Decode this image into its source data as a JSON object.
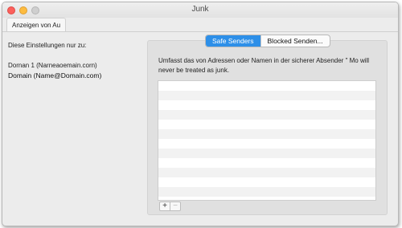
{
  "window": {
    "title": "Junk"
  },
  "toolbar": {
    "tab_label": "Anzeigen von Au"
  },
  "left_pane": {
    "settings_label": "Diese Einstellungen nur zu:",
    "account_name": "Dornan 1 (Narneaoemain.corn)",
    "account_address": "Domain (Name@Domain.com)"
  },
  "segmented": {
    "safe_label": "Safe Senders",
    "blocked_label": "Blocked Senden..."
  },
  "description": "Umfasst das von Adressen oder Namen in der sicherer Absender \" Mo will never be treated as junk.",
  "list_controls": {
    "add": "+",
    "remove": "−"
  },
  "colors": {
    "accent": "#2d8fe8",
    "close": "#fc605c",
    "minimize": "#fdbc40"
  }
}
